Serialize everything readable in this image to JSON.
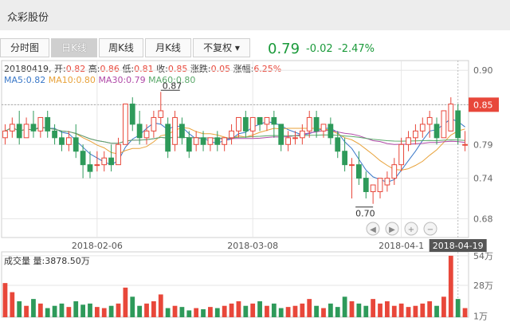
{
  "title": "众彩股份",
  "tabs": [
    {
      "label": "分时图",
      "active": false
    },
    {
      "label": "日K线",
      "active": true
    },
    {
      "label": "周K线",
      "active": false
    },
    {
      "label": "月K线",
      "active": false
    },
    {
      "label": "不复权 ▾",
      "active": false
    }
  ],
  "quote": {
    "price": "0.79",
    "change": "-0.02",
    "percent": "-2.47%"
  },
  "info": {
    "date": "20180419",
    "open_label": "开:",
    "open": "0.82",
    "high_label": "高:",
    "high": "0.86",
    "low_label": "低:",
    "low": "0.81",
    "close_label": "收:",
    "close": "0.85",
    "chg_label": "涨跌:",
    "chg": "0.05",
    "amp_label": "涨幅:",
    "amp": "6.25%"
  },
  "ma": {
    "ma5": "MA5:0.82",
    "ma10": "MA10:0.80",
    "ma30": "MA30:0.79",
    "ma60": "MA60:0.80"
  },
  "volume_title": "成交量 量:3878.50万",
  "colors": {
    "up": "#e8473a",
    "down": "#2e9a5a",
    "grid": "#e6e6e6",
    "axis": "#999999"
  },
  "chart_data": {
    "type": "candlestick",
    "price_axis": {
      "ticks": [
        "0.90",
        "0.85",
        "0.79",
        "0.74",
        "0.68"
      ],
      "values": [
        0.9,
        0.849,
        0.79,
        0.74,
        0.68
      ],
      "ylim": [
        0.652,
        0.905
      ]
    },
    "current_price_label": "0.85",
    "current_price_value": 0.849,
    "high_marker": {
      "label": "0.87",
      "value": 0.868,
      "index": 22
    },
    "low_marker": {
      "label": "0.70",
      "value": 0.702,
      "index": 52
    },
    "x_ticks": [
      {
        "label": "2018-02-06",
        "index": 13
      },
      {
        "label": "2018-03-08",
        "index": 35
      },
      {
        "label": "2018-04-1",
        "index": 56
      }
    ],
    "crosshair_date": "2018-04-19",
    "crosshair_index": 64,
    "volume_axis": {
      "ticks": [
        "54万",
        "28万",
        "1万"
      ],
      "values": [
        54,
        28,
        1
      ],
      "ylim": [
        0,
        56
      ]
    },
    "candles": [
      [
        0.8,
        0.82,
        0.81,
        0.79
      ],
      [
        0.81,
        0.83,
        0.82,
        0.8
      ],
      [
        0.82,
        0.84,
        0.8,
        0.79
      ],
      [
        0.8,
        0.83,
        0.82,
        0.8
      ],
      [
        0.82,
        0.84,
        0.81,
        0.8
      ],
      [
        0.81,
        0.83,
        0.83,
        0.8
      ],
      [
        0.83,
        0.84,
        0.81,
        0.8
      ],
      [
        0.81,
        0.82,
        0.8,
        0.79
      ],
      [
        0.8,
        0.81,
        0.79,
        0.78
      ],
      [
        0.79,
        0.81,
        0.8,
        0.78
      ],
      [
        0.8,
        0.82,
        0.78,
        0.77
      ],
      [
        0.78,
        0.79,
        0.76,
        0.74
      ],
      [
        0.76,
        0.78,
        0.75,
        0.74
      ],
      [
        0.76,
        0.78,
        0.76,
        0.75
      ],
      [
        0.76,
        0.78,
        0.77,
        0.75
      ],
      [
        0.77,
        0.79,
        0.76,
        0.75
      ],
      [
        0.76,
        0.8,
        0.79,
        0.76
      ],
      [
        0.79,
        0.85,
        0.85,
        0.79
      ],
      [
        0.85,
        0.86,
        0.82,
        0.81
      ],
      [
        0.82,
        0.84,
        0.8,
        0.79
      ],
      [
        0.8,
        0.82,
        0.81,
        0.79
      ],
      [
        0.81,
        0.84,
        0.83,
        0.8
      ],
      [
        0.83,
        0.868,
        0.84,
        0.82
      ],
      [
        0.82,
        0.83,
        0.78,
        0.77
      ],
      [
        0.79,
        0.84,
        0.83,
        0.78
      ],
      [
        0.82,
        0.83,
        0.8,
        0.79
      ],
      [
        0.8,
        0.81,
        0.78,
        0.77
      ],
      [
        0.79,
        0.81,
        0.8,
        0.78
      ],
      [
        0.8,
        0.81,
        0.79,
        0.78
      ],
      [
        0.79,
        0.8,
        0.8,
        0.78
      ],
      [
        0.8,
        0.81,
        0.79,
        0.78
      ],
      [
        0.79,
        0.8,
        0.8,
        0.78
      ],
      [
        0.8,
        0.82,
        0.81,
        0.79
      ],
      [
        0.81,
        0.83,
        0.83,
        0.8
      ],
      [
        0.83,
        0.84,
        0.81,
        0.8
      ],
      [
        0.81,
        0.83,
        0.83,
        0.8
      ],
      [
        0.83,
        0.83,
        0.82,
        0.81
      ],
      [
        0.82,
        0.83,
        0.83,
        0.81
      ],
      [
        0.83,
        0.84,
        0.82,
        0.8
      ],
      [
        0.82,
        0.82,
        0.79,
        0.78
      ],
      [
        0.79,
        0.81,
        0.8,
        0.78
      ],
      [
        0.8,
        0.81,
        0.8,
        0.79
      ],
      [
        0.8,
        0.82,
        0.81,
        0.79
      ],
      [
        0.81,
        0.84,
        0.83,
        0.8
      ],
      [
        0.83,
        0.84,
        0.81,
        0.8
      ],
      [
        0.81,
        0.82,
        0.82,
        0.8
      ],
      [
        0.82,
        0.83,
        0.8,
        0.79
      ],
      [
        0.8,
        0.81,
        0.78,
        0.77
      ],
      [
        0.78,
        0.8,
        0.76,
        0.75
      ],
      [
        0.76,
        0.77,
        0.76,
        0.71
      ],
      [
        0.76,
        0.78,
        0.74,
        0.73
      ],
      [
        0.74,
        0.75,
        0.72,
        0.71
      ],
      [
        0.72,
        0.73,
        0.73,
        0.702
      ],
      [
        0.72,
        0.74,
        0.74,
        0.71
      ],
      [
        0.73,
        0.75,
        0.74,
        0.72
      ],
      [
        0.74,
        0.77,
        0.76,
        0.73
      ],
      [
        0.76,
        0.8,
        0.79,
        0.75
      ],
      [
        0.79,
        0.81,
        0.8,
        0.78
      ],
      [
        0.8,
        0.82,
        0.81,
        0.79
      ],
      [
        0.81,
        0.83,
        0.82,
        0.8
      ],
      [
        0.82,
        0.84,
        0.83,
        0.8
      ],
      [
        0.82,
        0.83,
        0.8,
        0.79
      ],
      [
        0.8,
        0.84,
        0.84,
        0.8
      ],
      [
        0.81,
        0.86,
        0.85,
        0.81
      ],
      [
        0.84,
        0.85,
        0.8,
        0.79
      ],
      [
        0.79,
        0.81,
        0.79,
        0.78
      ]
    ],
    "volumes": [
      30,
      22,
      14,
      10,
      16,
      12,
      8,
      10,
      12,
      9,
      14,
      11,
      12,
      9,
      8,
      10,
      12,
      26,
      18,
      10,
      12,
      14,
      20,
      8,
      10,
      9,
      6,
      8,
      7,
      9,
      8,
      10,
      12,
      14,
      10,
      12,
      14,
      10,
      12,
      8,
      9,
      10,
      12,
      16,
      10,
      8,
      12,
      9,
      18,
      14,
      12,
      10,
      16,
      12,
      14,
      10,
      12,
      9,
      10,
      12,
      14,
      10,
      18,
      54,
      16,
      8
    ]
  }
}
